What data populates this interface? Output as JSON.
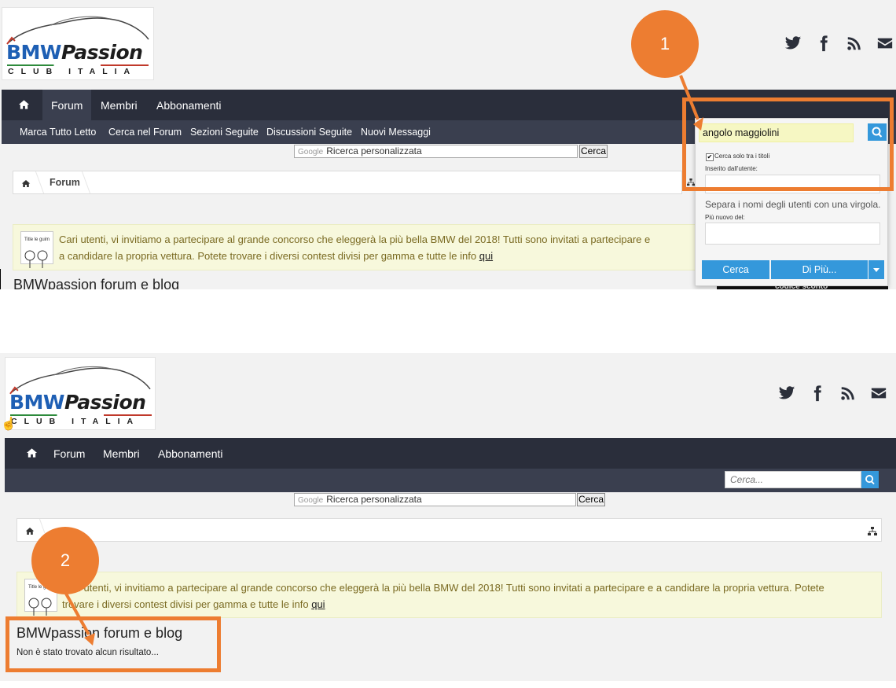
{
  "logo": {
    "brand_a": "BMW",
    "brand_b": "Passion",
    "sub": "CLUB ITALIA"
  },
  "nav": {
    "forum": "Forum",
    "membri": "Membri",
    "abbonamenti": "Abbonamenti"
  },
  "subnav": {
    "marca": "Marca Tutto Letto",
    "cerca_forum": "Cerca nel Forum",
    "sezioni": "Sezioni Seguite",
    "discussioni": "Discussioni Seguite",
    "nuovi": "Nuovi Messaggi"
  },
  "google": {
    "label": "Google",
    "placeholder": "Ricerca personalizzata",
    "button": "Cerca"
  },
  "breadcrumb": {
    "forum": "Forum"
  },
  "notice": {
    "text_top_1": "Cari utenti, vi invitiamo a partecipare al grande concorso che eleggerà la più bella BMW del 2018! Tutti sono invitati a partecipare e",
    "text_top_2": "a candidare la propria vettura. Potete trovare i diversi contest divisi per gamma e tutte le info",
    "text_bot_1": "Cari utenti, vi invitiamo a partecipare al grande concorso che eleggerà la più bella BMW del 2018! Tutti sono invitati a partecipare e a candidare la propria vettura. Potete",
    "text_bot_2": "trovare i diversi contest divisi per gamma e tutte le info",
    "link": "qui",
    "avatar_caption": "Title le guim"
  },
  "page_title": "BMWpassion forum e blog",
  "no_results": "Non è stato trovato alcun risultato...",
  "search_dropdown": {
    "query": "angolo maggiolini",
    "titles_only": "Cerca solo tra i titoli",
    "posted_by": "Inserito dall'utente:",
    "separate_hint": "Separa i nomi degli utenti con una virgola.",
    "newer_than": "Più nuovo del:",
    "cerca": "Cerca",
    "more": "Di Più...",
    "promo": "codice sconto"
  },
  "header_search": {
    "placeholder": "Cerca..."
  },
  "annotations": {
    "step1": "1",
    "step2": "2",
    "color": "#ed7d31"
  },
  "colors": {
    "nav_bg": "#2a2e3b",
    "subnav_bg": "#3a3f4f",
    "accent": "#3498db",
    "notice_bg": "#f7f8dc"
  }
}
